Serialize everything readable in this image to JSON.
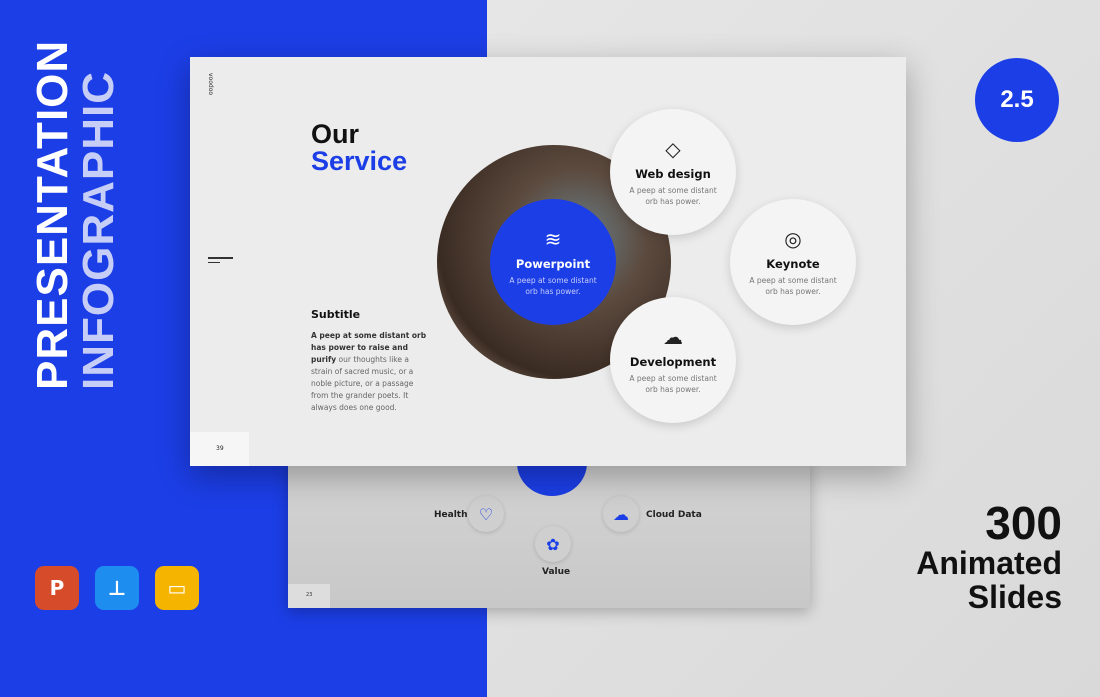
{
  "colors": {
    "accent": "#1c3ee6",
    "background": "#e3e3e3"
  },
  "side_title": [
    "PRESENTATION",
    "INFOGRAPHIC"
  ],
  "apps": [
    {
      "icon": "powerpoint-icon",
      "glyph": "P",
      "color": "#d64b2a"
    },
    {
      "icon": "keynote-icon",
      "glyph": "⊥",
      "color": "#1e8df0"
    },
    {
      "icon": "google-slides-icon",
      "glyph": "▭",
      "color": "#f4b400"
    }
  ],
  "version_badge": "2.5",
  "promo": {
    "count": "300",
    "line1": "Animated",
    "line2": "Slides"
  },
  "slide": {
    "brand": "voodoo",
    "title_line1": "Our",
    "title_line2": "Service",
    "subtitle": "Subtitle",
    "body_bold": "A peep at some distant orb has power to raise and purify",
    "body_rest": " our thoughts like a strain of sacred music, or a noble picture, or a passage from the grander poets. It always does one good.",
    "page_number": "39",
    "services": [
      {
        "name": "Powerpoint",
        "desc": "A peep at some distant orb has power.",
        "icon": "layers-icon",
        "glyph": "≋"
      },
      {
        "name": "Web design",
        "desc": "A peep at some distant orb has power.",
        "icon": "diamond-icon",
        "glyph": "◇"
      },
      {
        "name": "Keynote",
        "desc": "A peep at some distant orb has power.",
        "icon": "disc-icon",
        "glyph": "◎"
      },
      {
        "name": "Development",
        "desc": "A peep at some distant orb has power.",
        "icon": "cloud-download-icon",
        "glyph": "☁"
      }
    ]
  },
  "back_slide": {
    "page_number": "23",
    "items": [
      {
        "label": "Health",
        "glyph": "♡"
      },
      {
        "label": "Value",
        "glyph": "✿"
      },
      {
        "label": "Cloud Data",
        "glyph": "☁"
      }
    ]
  }
}
